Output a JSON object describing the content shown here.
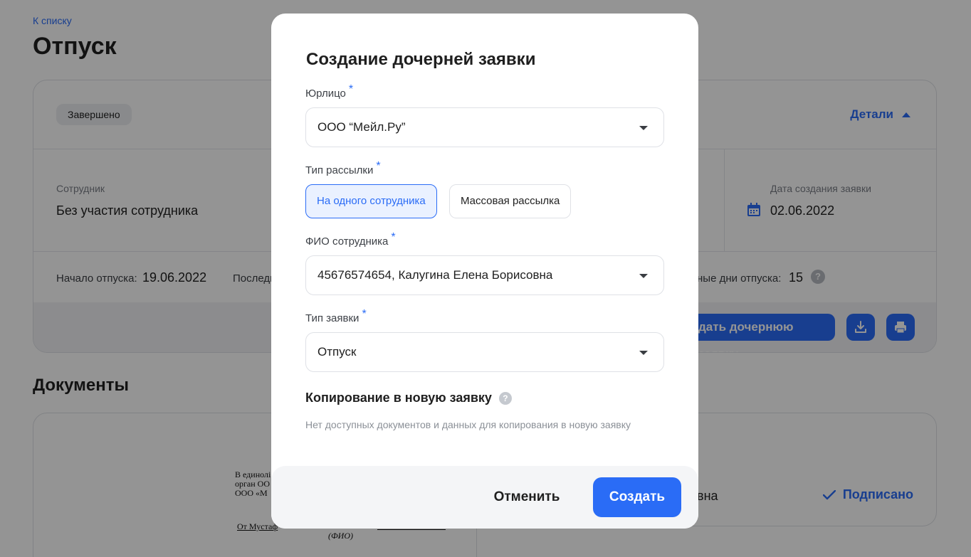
{
  "page": {
    "back_link": "К списку",
    "title": "Отпуск",
    "status_badge": "Завершено",
    "details_toggle": "Детали",
    "employee_label": "Сотрудник",
    "employee_value": "Без участия сотрудника",
    "created_label": "Дата создания заявки",
    "created_value": "02.06.2022",
    "vacation_start_label": "Начало отпуска:",
    "vacation_start_value": "19.06.2022",
    "vacation_last_label_fragment": "Последн",
    "vacation_days_label_fragment": "ные дни отпуска:",
    "vacation_days_value": "15",
    "create_child_fragment": "дать дочернюю заявку",
    "documents_title": "Документы",
    "doc_preview_lines": "В единолі\nорган ОО\nООО «М",
    "doc_preview_from": "От Мустаф",
    "doc_preview_fio": "(ФИО)",
    "doc_name_fragment": "вна",
    "signed_status": "Подписано"
  },
  "modal": {
    "title": "Создание дочерней заявки",
    "legal_entity": {
      "label": "Юрлицо",
      "required_mark": "*",
      "value": "ООО “Мейл.Ру”"
    },
    "mailing_type": {
      "label": "Тип рассылки",
      "required_mark": "*",
      "options": [
        "На одного сотрудника",
        "Массовая рассылка"
      ],
      "selected": "На одного сотрудника"
    },
    "employee": {
      "label": "ФИО сотрудника",
      "required_mark": "*",
      "value": "45676574654, Калугина Елена Борисовна"
    },
    "request_type": {
      "label": "Тип заявки",
      "required_mark": "*",
      "value": "Отпуск"
    },
    "copy_section": {
      "title": "Копирование в новую заявку",
      "help": "?",
      "note": "Нет доступных документов и данных для копирования в новую заявку"
    },
    "cancel_label": "Отменить",
    "create_label": "Создать"
  },
  "colors": {
    "accent": "#2a6cf6",
    "overlay": "rgba(0,0,0,0.42)"
  }
}
